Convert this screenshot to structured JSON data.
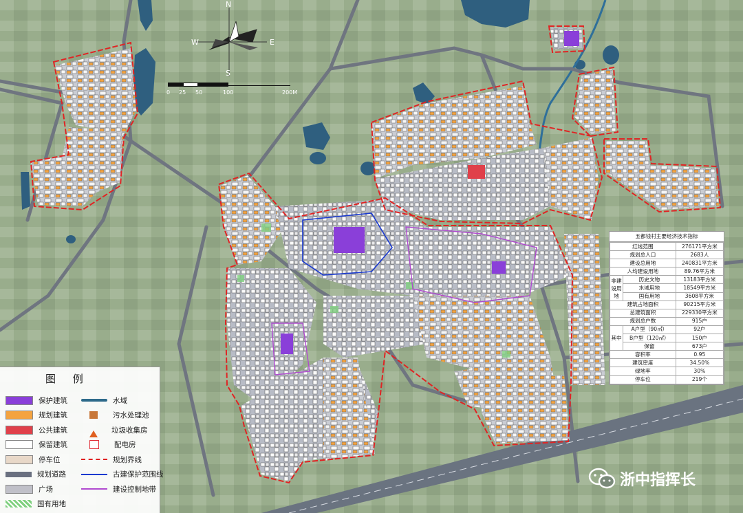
{
  "compass": {
    "north": "N",
    "south": "S",
    "west": "W",
    "east": "E"
  },
  "scale": {
    "labels": [
      "0",
      "25",
      "50",
      "100",
      "200M"
    ]
  },
  "legend": {
    "title": "图 例",
    "items": [
      {
        "key": "protect",
        "label": "保护建筑",
        "color": "#8a3fd9"
      },
      {
        "key": "water",
        "label": "水域",
        "color": "#2d6a8a"
      },
      {
        "key": "planned",
        "label": "规划建筑",
        "color": "#f4a340"
      },
      {
        "key": "sewage",
        "label": "污水处理池",
        "color": "#c8783a"
      },
      {
        "key": "public",
        "label": "公共建筑",
        "color": "#e0404a"
      },
      {
        "key": "garbage",
        "label": "垃圾收集房",
        "color": "#e06020"
      },
      {
        "key": "retained",
        "label": "保留建筑",
        "color": "#ffffff"
      },
      {
        "key": "power",
        "label": "配电房",
        "color": "#e0303a"
      },
      {
        "key": "parking",
        "label": "停车位",
        "color": "#e8d8c8"
      },
      {
        "key": "redline",
        "label": "规划界线",
        "color": "#e02020"
      },
      {
        "key": "road",
        "label": "规划道路",
        "color": "#6a7080"
      },
      {
        "key": "heritage",
        "label": "古建保护范围线",
        "color": "#1a3ad0"
      },
      {
        "key": "plaza",
        "label": "广场",
        "color": "#c0c0c8"
      },
      {
        "key": "control",
        "label": "建设控制地带",
        "color": "#b04ad0"
      },
      {
        "key": "state",
        "label": "国有用地",
        "color": "#7fd07f"
      }
    ]
  },
  "tech_table": {
    "title": "五都钱村主要经济技术指标",
    "rows": [
      {
        "label": "红线范围",
        "value": "276171平方米"
      },
      {
        "label": "规划总人口",
        "value": "2683人"
      },
      {
        "label": "建设总用地",
        "value": "240831平方米"
      },
      {
        "label": "人均建设用地",
        "value": "89.76平方米"
      },
      {
        "group": "非建设用地",
        "label": "历史文物",
        "value": "13183平方米"
      },
      {
        "group": "非建设用地",
        "label": "水域用地",
        "value": "18549平方米"
      },
      {
        "group": "非建设用地",
        "label": "国有用地",
        "value": "3608平方米"
      },
      {
        "label": "建筑占地面积",
        "value": "90215平方米"
      },
      {
        "label": "总建筑面积",
        "value": "229330平方米"
      },
      {
        "label": "规划总户数",
        "value": "915户"
      },
      {
        "group": "其中",
        "label": "A户型（90㎡）",
        "value": "92户"
      },
      {
        "group": "其中",
        "label": "B户型（120㎡）",
        "value": "150户"
      },
      {
        "group": "其中",
        "label": "保留",
        "value": "673户"
      },
      {
        "label": "容积率",
        "value": "0.95"
      },
      {
        "label": "建筑密度",
        "value": "34.50%"
      },
      {
        "label": "绿地率",
        "value": "30%"
      },
      {
        "label": "停车位",
        "value": "219个"
      }
    ],
    "groups": {
      "nonbuild": "非建设用地",
      "among": "其中"
    }
  },
  "watermark": {
    "text": "浙中指挥长"
  },
  "colors": {
    "field": "#9bb08f",
    "field2": "#a9bc9c",
    "road": "#6f7580",
    "water": "#2f5f7f",
    "planned": "#f4a340",
    "retained": "#f4f4f4",
    "red": "#e02424",
    "purple": "#8a3fd9"
  }
}
